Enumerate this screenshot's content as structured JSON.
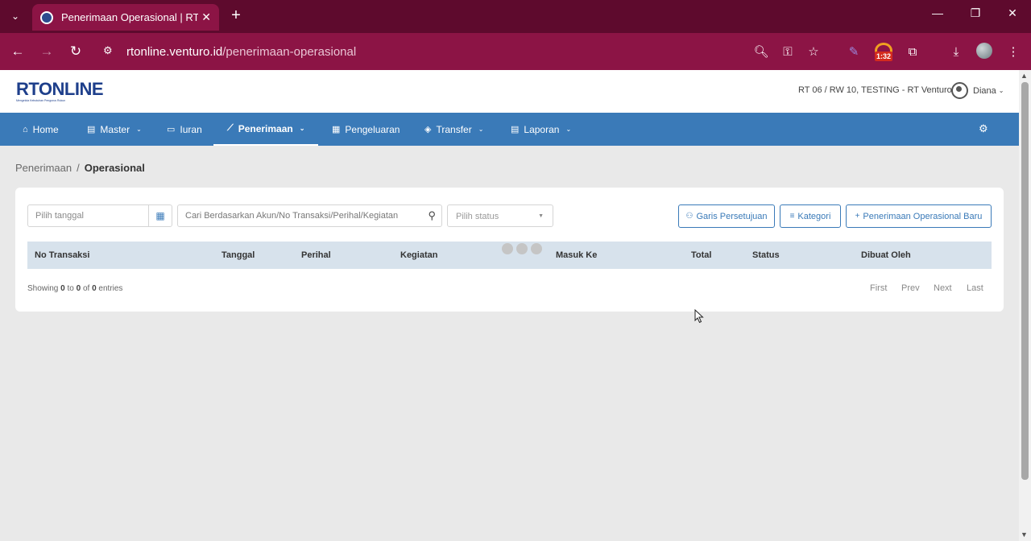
{
  "browser": {
    "tab_title": "Penerimaan Operasional | RT Online",
    "url_host": "rtonline.venturo.id",
    "url_path": "/penerimaan-operasional",
    "extension_badge": "1:32"
  },
  "header": {
    "logo_text": "RTONLINE",
    "logo_tagline": "Mengelola Kebutuhan Pengurus Rukun",
    "rt_info": "RT 06 / RW 10, TESTING - RT Venturo",
    "user_name": "Diana"
  },
  "nav": {
    "items": [
      {
        "label": "Home",
        "icon": "home-icon"
      },
      {
        "label": "Master",
        "icon": "file-icon"
      },
      {
        "label": "Iuran",
        "icon": "card-icon"
      },
      {
        "label": "Penerimaan",
        "icon": "chart-icon"
      },
      {
        "label": "Pengeluaran",
        "icon": "ledger-icon"
      },
      {
        "label": "Transfer",
        "icon": "tag-icon"
      },
      {
        "label": "Laporan",
        "icon": "file-icon"
      }
    ],
    "active": "Penerimaan"
  },
  "breadcrumb": {
    "parent": "Penerimaan",
    "separator": "/",
    "current": "Operasional"
  },
  "filters": {
    "date_placeholder": "Pilih tanggal",
    "search_placeholder": "Cari Berdasarkan Akun/No Transaksi/Perihal/Kegiatan",
    "status_placeholder": "Pilih status"
  },
  "actions": {
    "approval_label": "Garis Persetujuan",
    "category_label": "Kategori",
    "new_label": "Penerimaan Operasional Baru"
  },
  "table": {
    "columns": [
      "No Transaksi",
      "Tanggal",
      "Perihal",
      "Kegiatan",
      "Masuk Ke",
      "Total",
      "Status",
      "Dibuat Oleh"
    ]
  },
  "pagination": {
    "showing_prefix": "Showing",
    "from": "0",
    "to_word": "to",
    "to": "0",
    "of_word": "of",
    "total": "0",
    "suffix": "entries",
    "first": "First",
    "prev": "Prev",
    "next": "Next",
    "last": "Last"
  }
}
